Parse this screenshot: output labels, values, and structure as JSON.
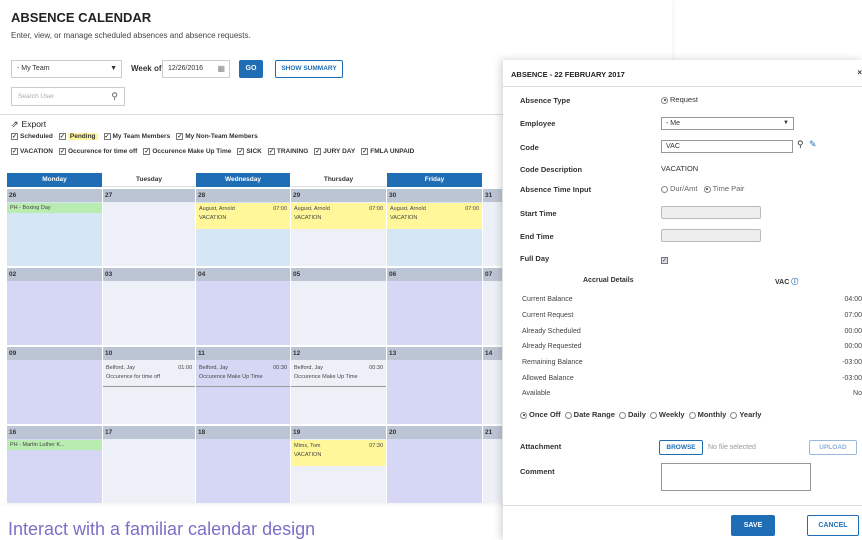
{
  "calendar": {
    "title": "ABSENCE CALENDAR",
    "subtitle": "Enter, view, or manage scheduled absences and absence requests.",
    "team_select": "- My Team",
    "week_of_label": "Week of",
    "week_of_value": "12/26/2016",
    "go_label": "GO",
    "summary_label": "SHOW SUMMARY",
    "search_placeholder": "Search User",
    "export_label": "Export",
    "filters_row1": [
      "Scheduled",
      "Pending",
      "My Team Members",
      "My Non-Team Members"
    ],
    "filters_row2": [
      "VACATION",
      "Occurence for time off",
      "Occurence Make Up Time",
      "SICK",
      "TRAINING",
      "JURY DAY",
      "FMLA UNPAID"
    ],
    "day_headers": [
      "Monday",
      "Tuesday",
      "Wednesday",
      "Thursday",
      "Friday"
    ],
    "weeks": [
      {
        "days": [
          "26",
          "27",
          "28",
          "29",
          "30",
          "31"
        ]
      },
      {
        "days": [
          "02",
          "03",
          "04",
          "05",
          "06",
          "07"
        ]
      },
      {
        "days": [
          "09",
          "10",
          "11",
          "12",
          "13",
          "14"
        ]
      },
      {
        "days": [
          "16",
          "17",
          "18",
          "19",
          "20",
          "21"
        ]
      }
    ],
    "events": {
      "w0_mon": "PH - Boxing Day",
      "w0_wed_name": "August, Arnold",
      "w0_wed_time": "07:00",
      "w0_wed_type": "VACATION",
      "w0_thu_name": "August, Arnold",
      "w0_thu_time": "07:00",
      "w0_thu_type": "VACATION",
      "w0_fri_name": "August, Arnold",
      "w0_fri_time": "07:00",
      "w0_fri_type": "VACATION",
      "w2_tue_name": "Belford, Jay",
      "w2_tue_time": "01:00",
      "w2_tue_type": "Occurence for time off",
      "w2_wed_name": "Belford, Jay",
      "w2_wed_time": "00:30",
      "w2_wed_type": "Occurence Make Up Time",
      "w2_thu_name": "Belford, Jay",
      "w2_thu_time": "00:30",
      "w2_thu_type": "Occurence Make Up Time",
      "w3_mon": "PH - Martin Luther K...",
      "w3_thu_name": "Mims, Tom",
      "w3_thu_time": "07:30",
      "w3_thu_type": "VACATION"
    },
    "caption": "Interact with a familiar calendar design",
    "colors": {
      "accent": "#1f6eb5",
      "pending": "#fff79a",
      "holiday": "#b9ecb0",
      "caption": "#7e6ec7"
    }
  },
  "panel": {
    "title": "ABSENCE - 22 FEBRUARY 2017",
    "absence_type_label": "Absence Type",
    "absence_type_value": "Request",
    "employee_label": "Employee",
    "employee_value": "- Me",
    "code_label": "Code",
    "code_value": "VAC",
    "code_desc_label": "Code Description",
    "code_desc_value": "VACATION",
    "time_input_label": "Absence Time Input",
    "time_input_opt1": "Dur/Amt",
    "time_input_opt2": "Time Pair",
    "start_time_label": "Start Time",
    "end_time_label": "End Time",
    "full_day_label": "Full Day",
    "accrual_header": "Accrual Details",
    "accrual_code": "VAC",
    "accrual_rows": [
      {
        "label": "Current Balance",
        "value": "04:00"
      },
      {
        "label": "Current Request",
        "value": "07:00"
      },
      {
        "label": "Already Scheduled",
        "value": "00:00"
      },
      {
        "label": "Already Requested",
        "value": "00:00"
      },
      {
        "label": "Remaining Balance",
        "value": "-03:00"
      },
      {
        "label": "Allowed Balance",
        "value": "-03:00"
      },
      {
        "label": "Available",
        "value": "No"
      }
    ],
    "frequency": [
      "Once Off",
      "Date Range",
      "Daily",
      "Weekly",
      "Monthly",
      "Yearly"
    ],
    "attachment_label": "Attachment",
    "browse_label": "BROWSE",
    "no_file_label": "No file selected",
    "upload_label": "UPLOAD",
    "comment_label": "Comment",
    "save_label": "SAVE",
    "cancel_label": "CANCEL"
  }
}
